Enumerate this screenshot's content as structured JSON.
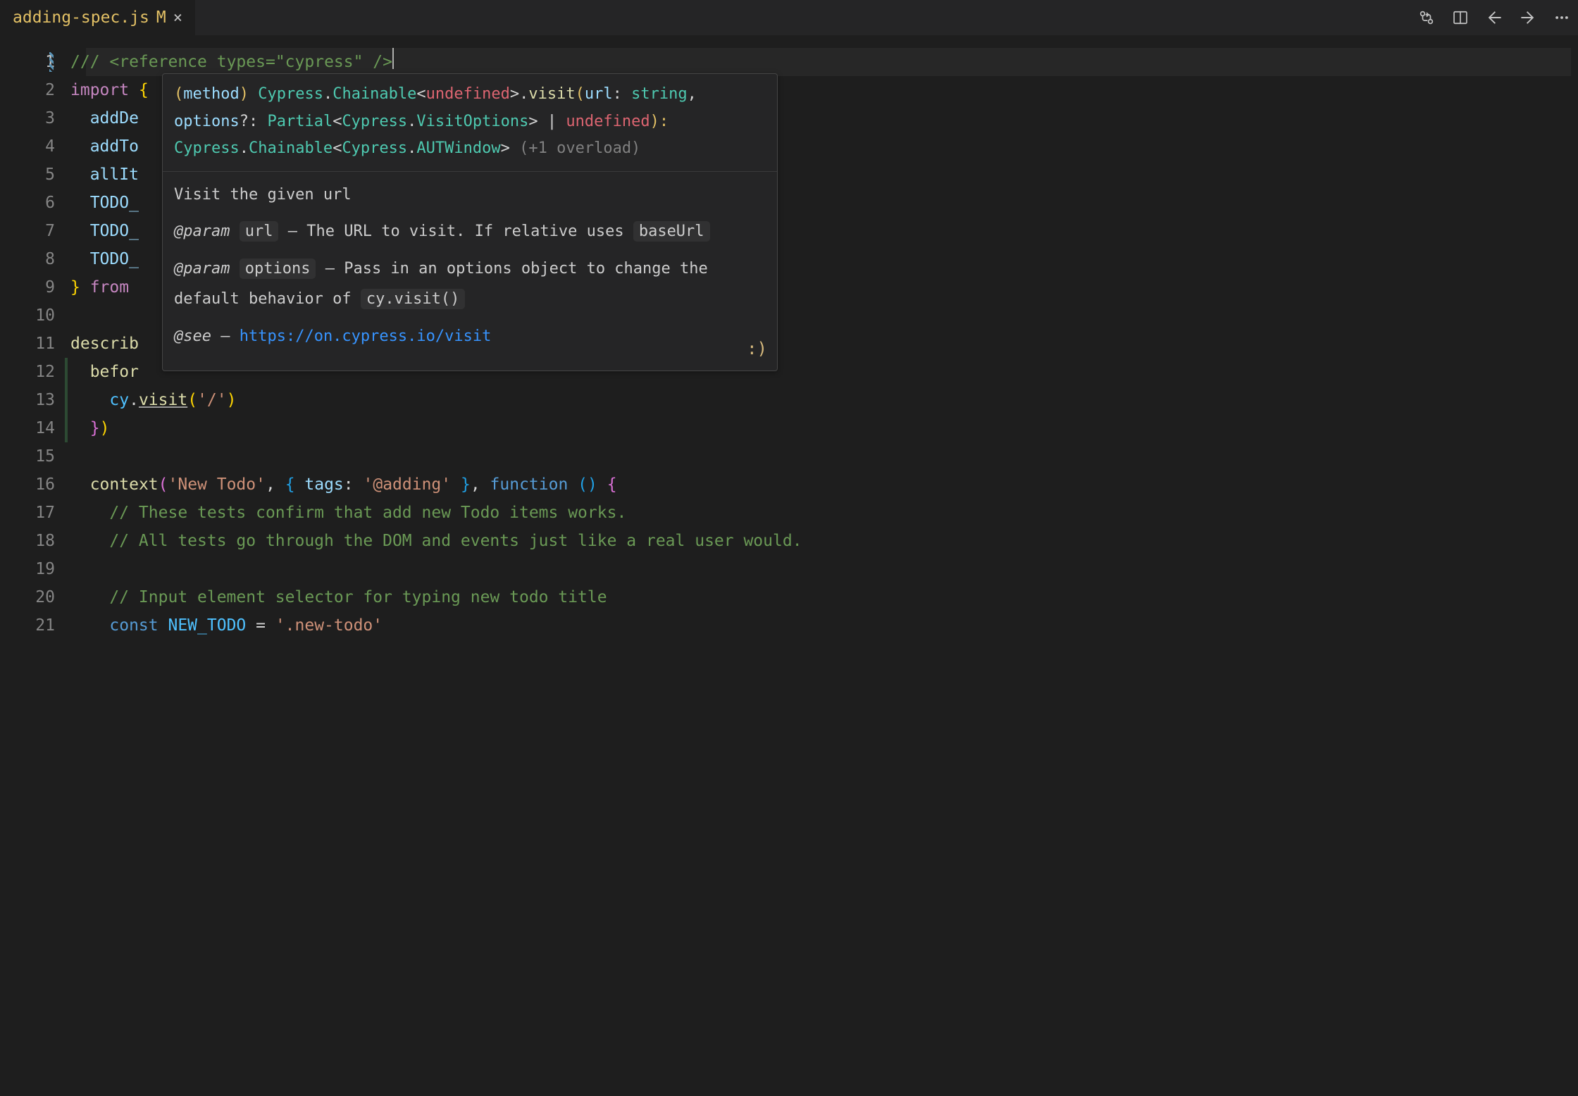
{
  "tab": {
    "filename": "adding-spec.js",
    "modified_indicator": "M",
    "close_glyph": "×"
  },
  "lines": {
    "total": 21,
    "current": 1
  },
  "code": {
    "l1": {
      "c": "/// ",
      "ref_open": "<reference ",
      "attr": "types",
      "eq": "=",
      "val": "\"cypress\"",
      "close": " />"
    },
    "l2": {
      "kw": "import ",
      "brace": "{"
    },
    "l3": {
      "id": "addDe"
    },
    "l4": {
      "id": "addTo"
    },
    "l5": {
      "id": "allIt"
    },
    "l6": {
      "id": "TODO_"
    },
    "l7": {
      "id": "TODO_"
    },
    "l8": {
      "id": "TODO_"
    },
    "l9": {
      "brace": "}",
      "kw": " from "
    },
    "l11": {
      "fn": "describ"
    },
    "l12": {
      "id": "befor"
    },
    "l13": {
      "obj": "cy",
      "dot": ".",
      "fn": "visit",
      "p1": "(",
      "str": "'/'",
      "p2": ")"
    },
    "l14": {
      "brace": "}",
      "paren": ")"
    },
    "l16": {
      "fn": "context",
      "p1": "(",
      "str1": "'New Todo'",
      "comma1": ", ",
      "bo": "{",
      "key": " tags",
      "colon": ": ",
      "str2": "'@adding'",
      "bc": " }",
      "comma2": ", ",
      "kw": "function ",
      "pp": "()",
      "space": " ",
      "bo2": "{"
    },
    "l17": {
      "c": "// These tests confirm that add new Todo items works."
    },
    "l18": {
      "c": "// All tests go through the DOM and events just like a real user would."
    },
    "l20": {
      "c": "// Input element selector for typing new todo title"
    },
    "l21": {
      "kw": "const ",
      "id": "NEW_TODO",
      "op": " = ",
      "str": "'.new-todo'"
    }
  },
  "hover": {
    "sig": {
      "parenL": "(",
      "kind": "method",
      "parenR": ") ",
      "chain1": "Cypress",
      "dot1": ".",
      "chain2": "Chainable",
      "lt1": "<",
      "undef": "undefined",
      "gt1": ">",
      "dot2": ".",
      "visit": "visit",
      "args_open": "(",
      "arg1n": "url",
      "arg1c": ": ",
      "arg1t": "string",
      "comma": ", ",
      "arg2n": "options",
      "arg2q": "?: ",
      "partial": "Partial",
      "lt2": "<",
      "vopts": "Cypress",
      "dot3": ".",
      "voptst": "VisitOptions",
      "gt2": ">",
      "pipe": " | ",
      "undef2": "undefined",
      "args_close": "): ",
      "ret1": "Cypress",
      "dot4": ".",
      "ret2": "Chainable",
      "lt3": "<",
      "ret3": "Cypress",
      "dot5": ".",
      "ret4": "AUTWindow",
      "gt3": ">",
      "overload": " (+1 overload)"
    },
    "desc": "Visit the given url",
    "param1": {
      "tag": "@param",
      "name": "url",
      "dash": " — ",
      "text_a": "The URL to visit. If relative uses ",
      "code": "baseUrl"
    },
    "param2": {
      "tag": "@param",
      "name": "options",
      "dash": " — ",
      "text_a": "Pass in an options object to change the default behavior of ",
      "code": "cy.visit()"
    },
    "see": {
      "tag": "@see",
      "dash": " — ",
      "url": "https://on.cypress.io/visit"
    },
    "smiley": ":)"
  }
}
